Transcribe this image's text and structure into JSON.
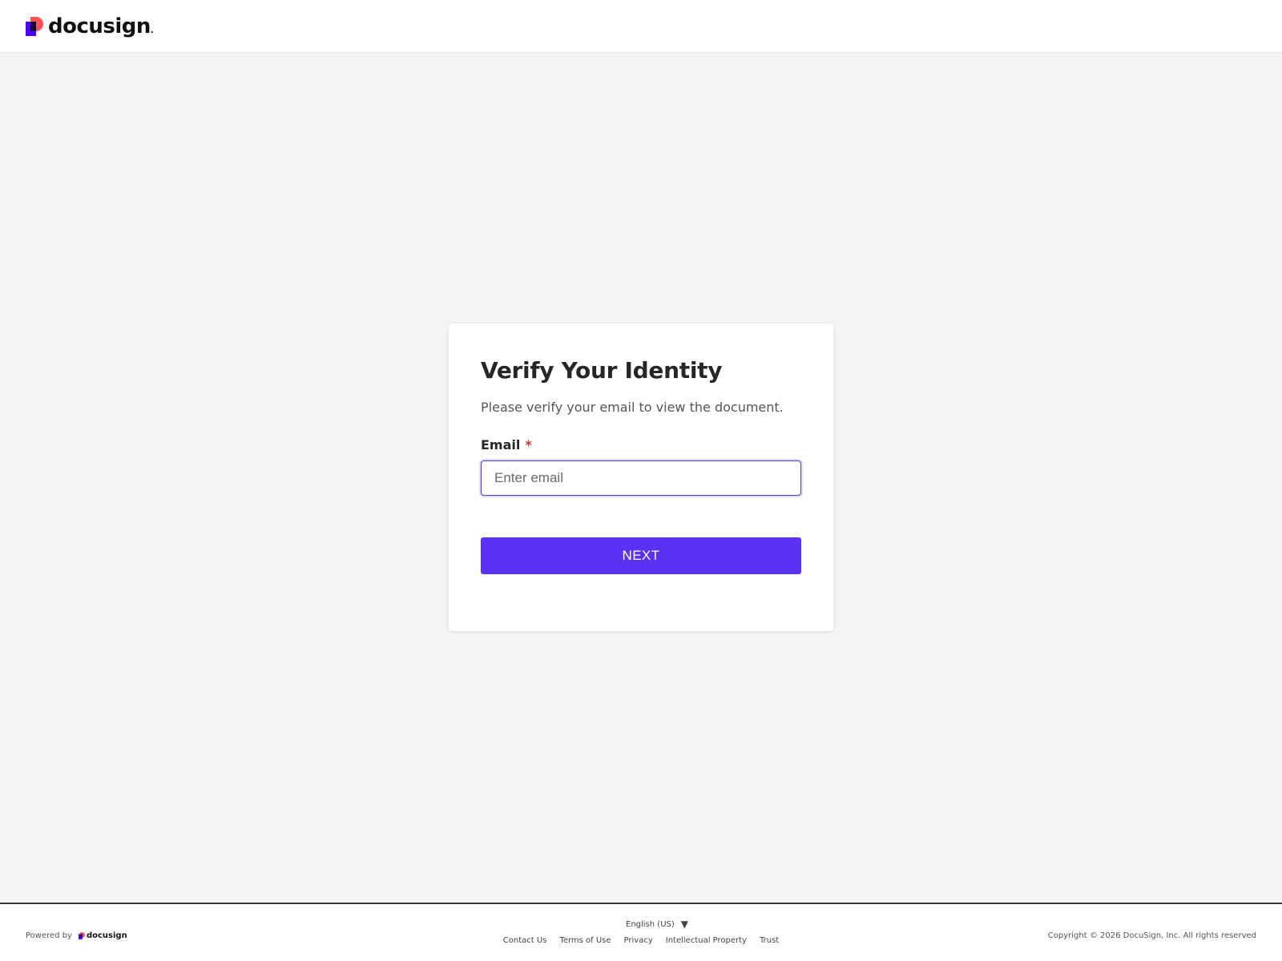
{
  "header": {
    "brand": "docusign",
    "brand_dot": ".",
    "colors": {
      "mark_pink": "#ff5252",
      "mark_purple": "#4c00ff",
      "mark_dark": "#1a0033"
    }
  },
  "card": {
    "title": "Verify Your Identity",
    "subtitle": "Please verify your email to view the document.",
    "email_label": "Email",
    "required_marker": "*",
    "email_placeholder": "Enter email",
    "email_value": "",
    "next_label": "NEXT",
    "colors": {
      "accent": "#5b32f3",
      "focus_border": "#5c3ad6",
      "required": "#d6322f"
    }
  },
  "footer": {
    "powered_by": "Powered by",
    "brand": "docusign",
    "language": "English (US)",
    "language_icon": "caret-down-icon",
    "links": [
      "Contact Us",
      "Terms of Use",
      "Privacy",
      "Intellectual Property",
      "Trust"
    ],
    "copyright": "Copyright © 2026 DocuSign, Inc. All rights reserved"
  }
}
